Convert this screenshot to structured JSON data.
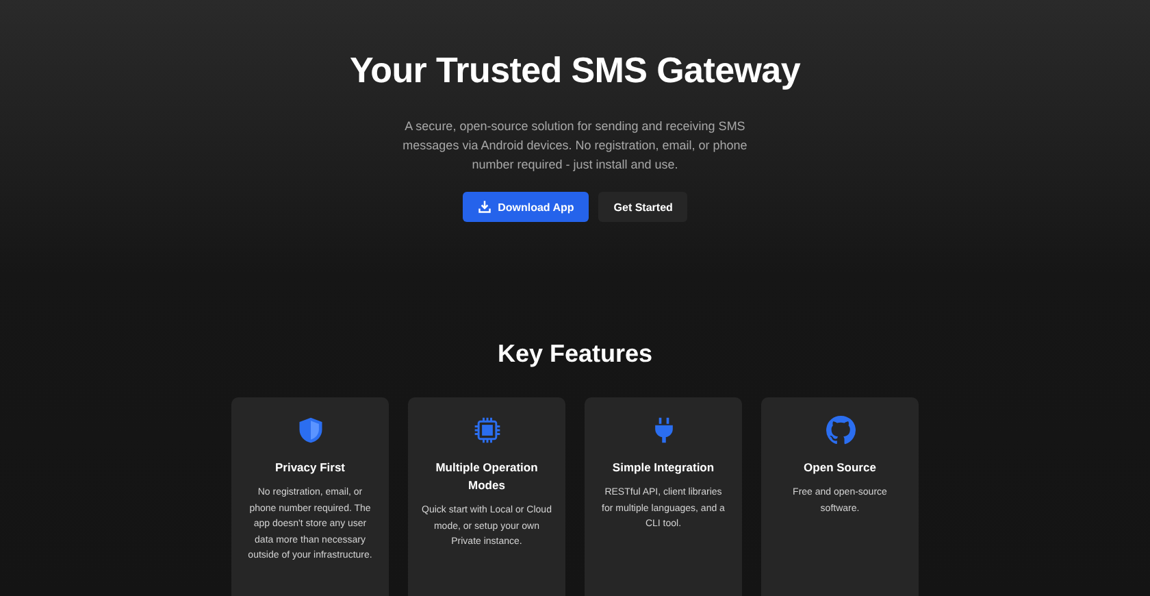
{
  "hero": {
    "title": "Your Trusted SMS Gateway",
    "description": "A secure, open-source solution for sending and receiving SMS messages via Android devices. No registration, email, or phone number required - just install and use.",
    "buttons": [
      {
        "label": "Download App",
        "kind": "primary"
      },
      {
        "label": "Get Started",
        "kind": "secondary"
      }
    ]
  },
  "features": {
    "title": "Key Features",
    "cards": [
      {
        "title": "Privacy First",
        "text": "No registration, email, or phone number required. The app doesn't store any user data more than necessary outside of your infrastructure."
      },
      {
        "title": "Multiple Operation Modes",
        "text": "Quick start with Local or Cloud mode, or setup your own Private instance."
      },
      {
        "title": "Simple Integration",
        "text": "RESTful API, client libraries for multiple languages, and a CLI tool."
      },
      {
        "title": "Open Source",
        "text": "Free and open-source software."
      }
    ]
  }
}
